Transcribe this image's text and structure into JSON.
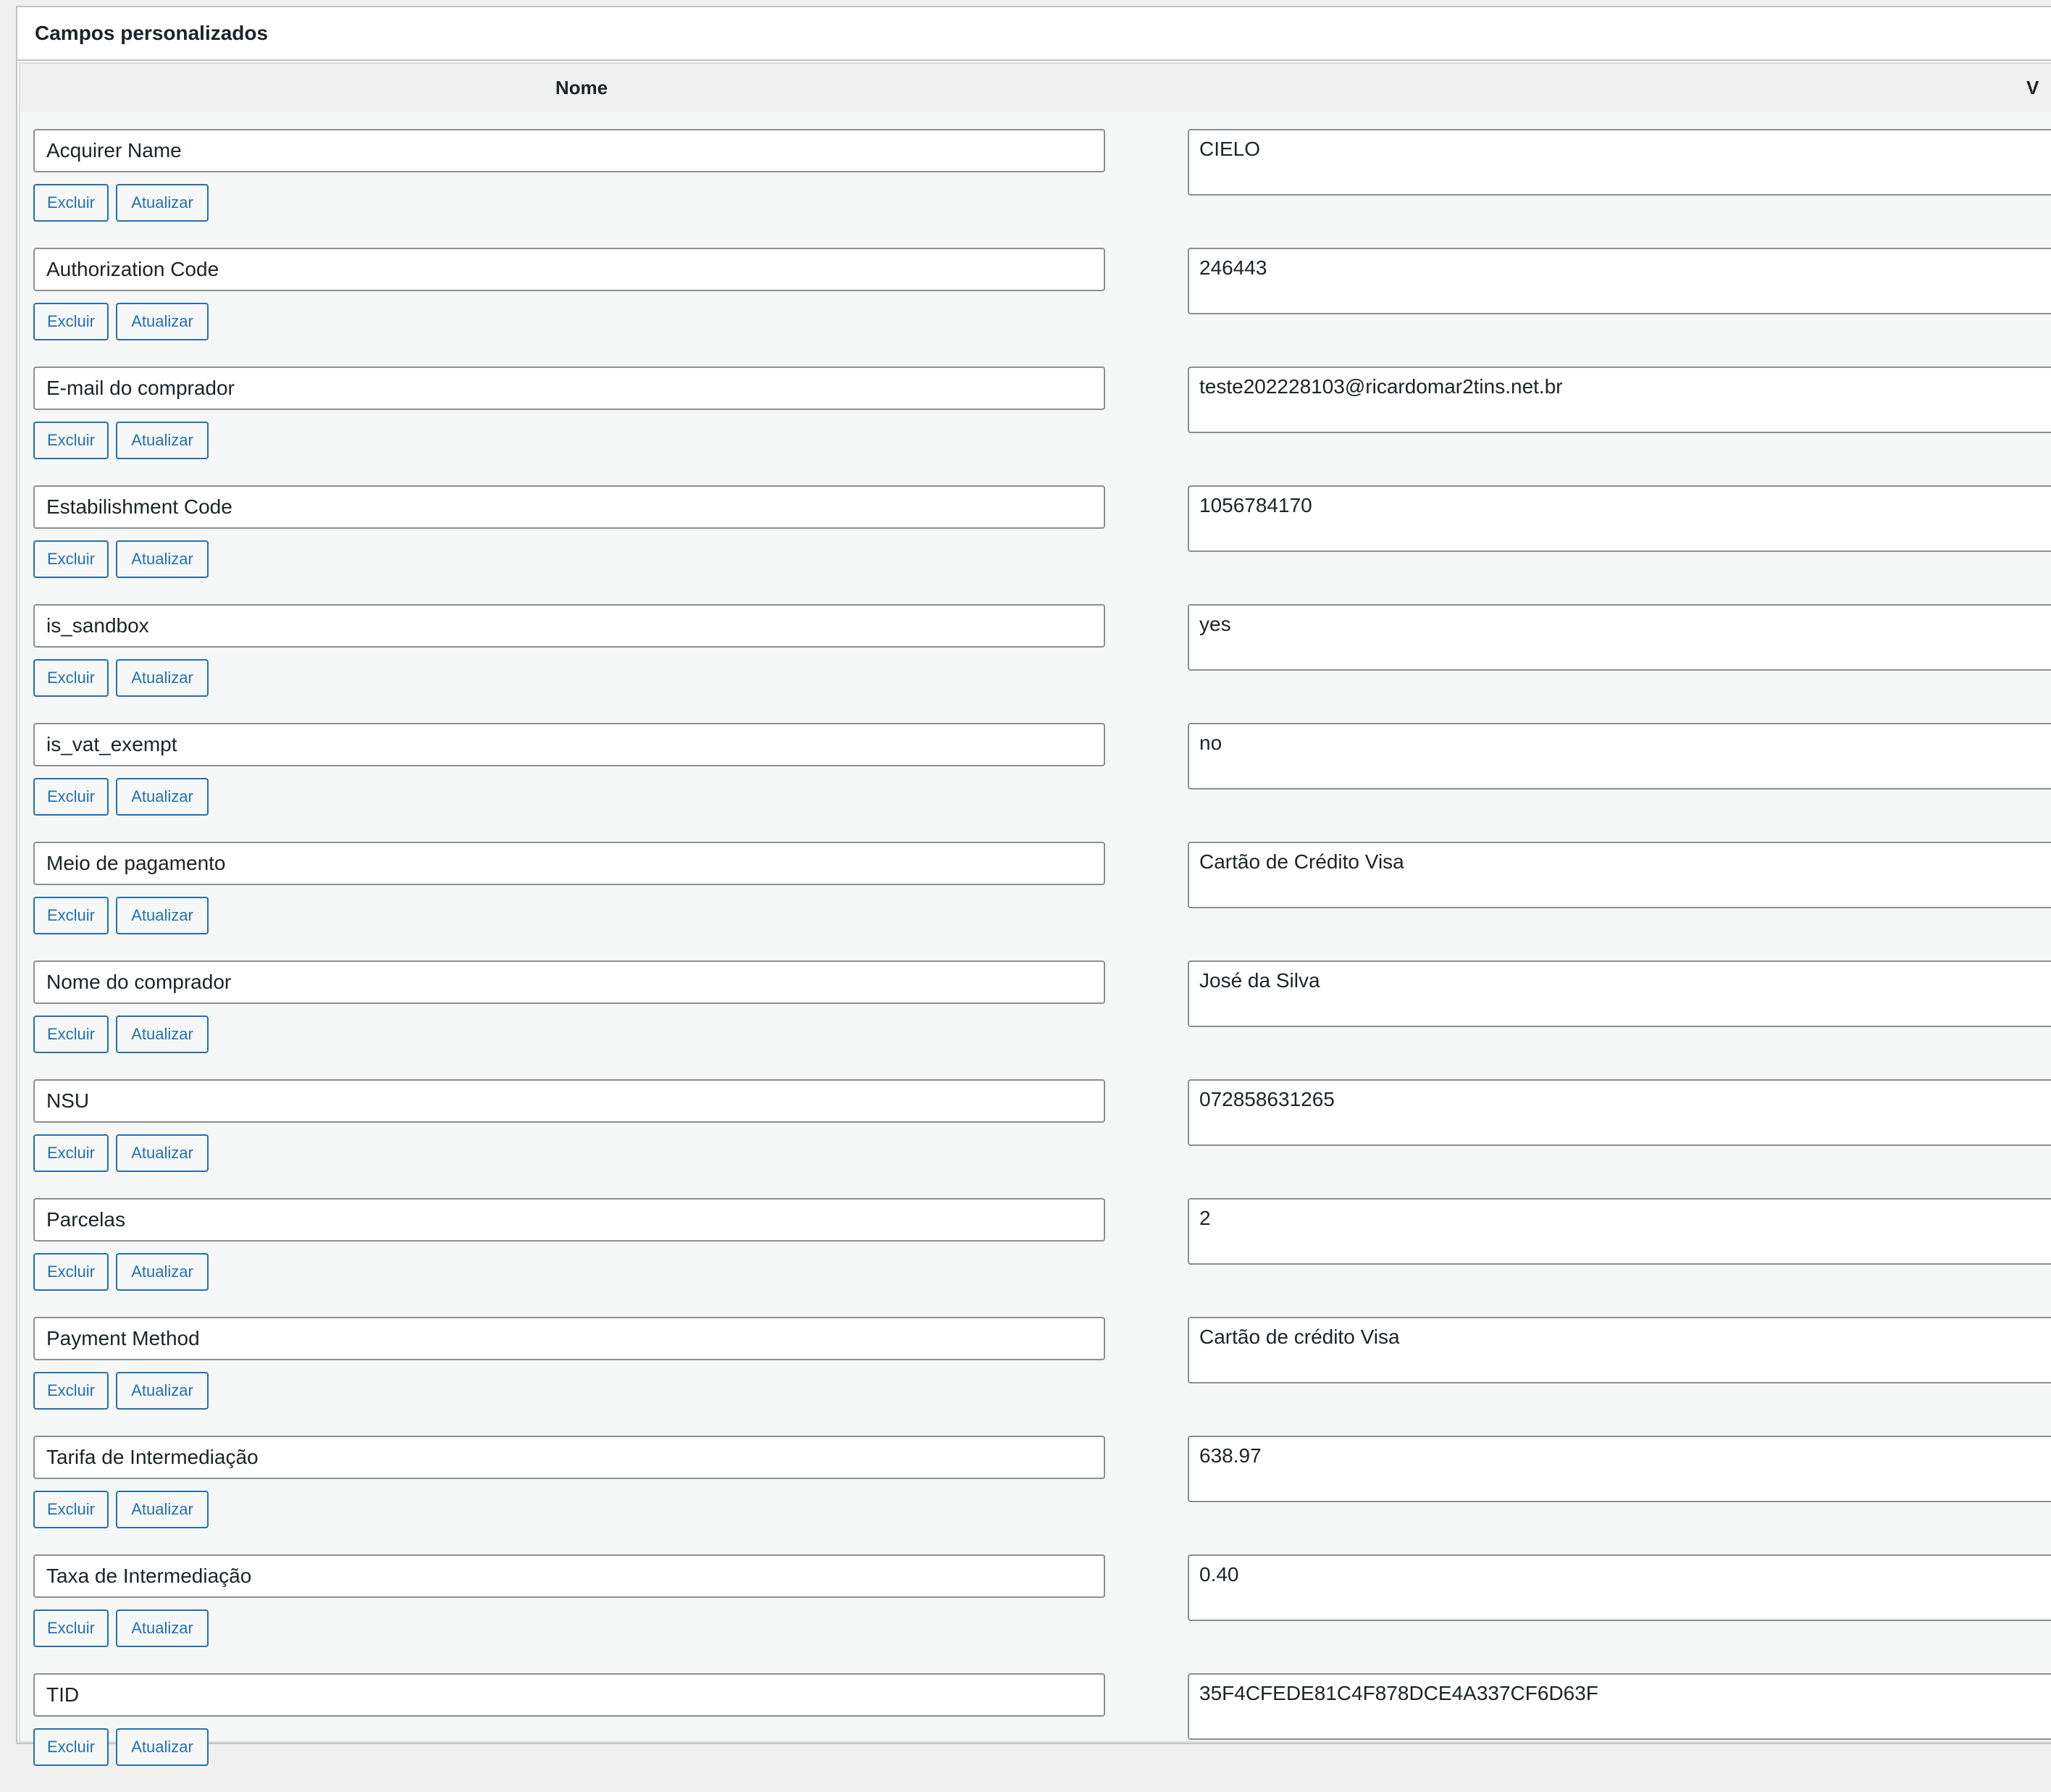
{
  "metabox": {
    "title": "Campos personalizados"
  },
  "table": {
    "header_name": "Nome",
    "header_value": "V"
  },
  "buttons": {
    "delete_label": "Excluir",
    "update_label": "Atualizar"
  },
  "fields": [
    {
      "name": "Acquirer Name",
      "value": "CIELO"
    },
    {
      "name": "Authorization Code",
      "value": "246443"
    },
    {
      "name": "E-mail do comprador",
      "value": "teste202228103@ricardomar2tins.net.br"
    },
    {
      "name": "Estabilishment Code",
      "value": "1056784170"
    },
    {
      "name": "is_sandbox",
      "value": "yes"
    },
    {
      "name": "is_vat_exempt",
      "value": "no"
    },
    {
      "name": "Meio de pagamento",
      "value": "Cartão de Crédito Visa"
    },
    {
      "name": "Nome do comprador",
      "value": "José da Silva"
    },
    {
      "name": "NSU",
      "value": "072858631265"
    },
    {
      "name": "Parcelas",
      "value": "2"
    },
    {
      "name": "Payment Method",
      "value": "Cartão de crédito Visa"
    },
    {
      "name": "Tarifa de Intermediação",
      "value": "638.97"
    },
    {
      "name": "Taxa de Intermediação",
      "value": "0.40"
    },
    {
      "name": "TID",
      "value": "35F4CFEDE81C4F878DCE4A337CF6D63F"
    }
  ]
}
